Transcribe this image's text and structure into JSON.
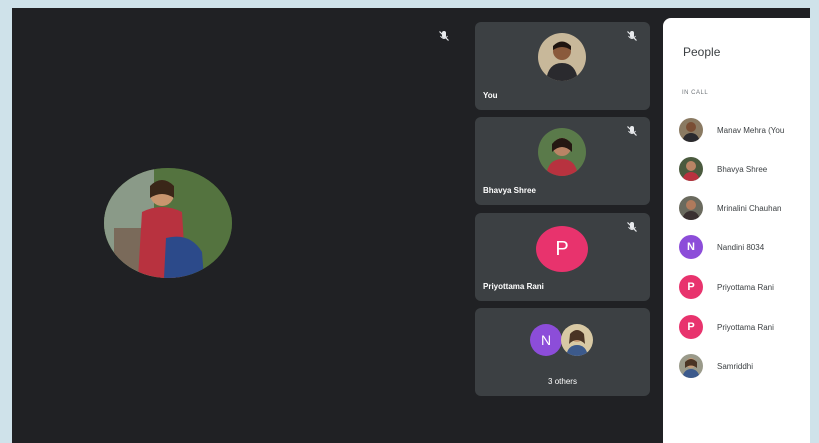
{
  "main_stage": {
    "mic_icon": "mic-off-icon"
  },
  "tiles": [
    {
      "name": "You",
      "muted": true
    },
    {
      "name": "Bhavya Shree",
      "muted": true
    },
    {
      "name": "Priyottama Rani",
      "initial": "P",
      "color": "#e8336d",
      "muted": true
    },
    {
      "name": "3 others",
      "initial": "N",
      "color": "#8c4dd9"
    }
  ],
  "people": {
    "title": "People",
    "section": "IN CALL",
    "members": [
      {
        "name": "Manav Mehra (You"
      },
      {
        "name": "Bhavya Shree"
      },
      {
        "name": "Mrinalini Chauhan"
      },
      {
        "name": "Nandini 8034",
        "initial": "N",
        "color": "#8c4dd9"
      },
      {
        "name": "Priyottama Rani",
        "initial": "P",
        "color": "#e8336d"
      },
      {
        "name": "Priyottama Rani",
        "initial": "P",
        "color": "#e8336d"
      },
      {
        "name": "Samriddhi"
      }
    ]
  },
  "colors": {
    "background": "#202124",
    "tile": "#3c4043",
    "accent_pink": "#e8336d",
    "accent_purple": "#8c4dd9"
  }
}
